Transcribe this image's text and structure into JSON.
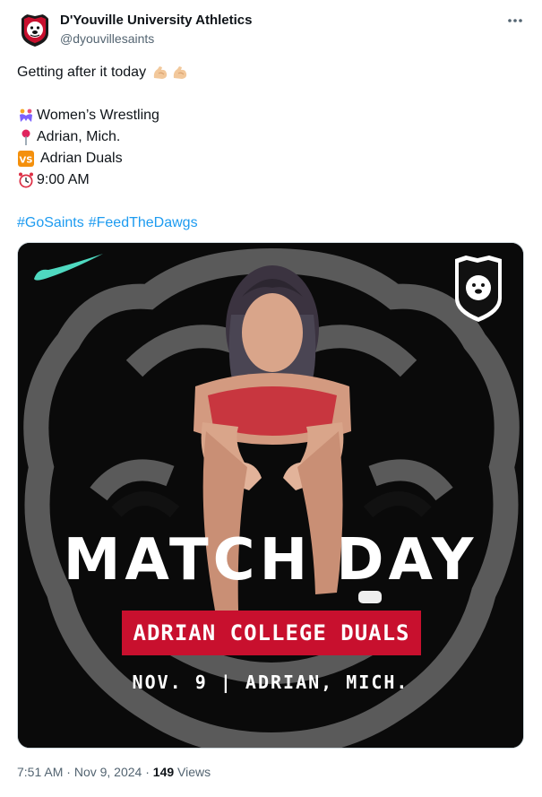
{
  "author": {
    "name": "D'Youville University Athletics",
    "handle": "@dyouvillesaints"
  },
  "menu": {
    "more_icon": "more-horizontal-icon"
  },
  "tweet": {
    "lines": {
      "intro": "Getting after it today",
      "sport": "Women’s Wrestling",
      "location": "Adrian, Mich.",
      "opponent": "Adrian Duals",
      "time": "9:00 AM",
      "hashtag1": "#GoSaints",
      "hashtag2": "#FeedTheDawgs"
    },
    "icons": [
      "flexed-biceps-icon",
      "wrestlers-icon",
      "pin-icon",
      "vs-icon",
      "alarm-clock-icon"
    ]
  },
  "graphic": {
    "title": "MATCH DAY",
    "banner": "ADRIAN COLLEGE DUALS",
    "date_line": "NOV. 9 | ADRIAN, MICH.",
    "banner_color": "#c8102e",
    "brand_swoosh_color": "#4fd9c0"
  },
  "footer": {
    "time": "7:51 AM",
    "sep1": "·",
    "date": "Nov 9, 2024",
    "sep2": "·",
    "views_count": "149",
    "views_label": "Views"
  }
}
